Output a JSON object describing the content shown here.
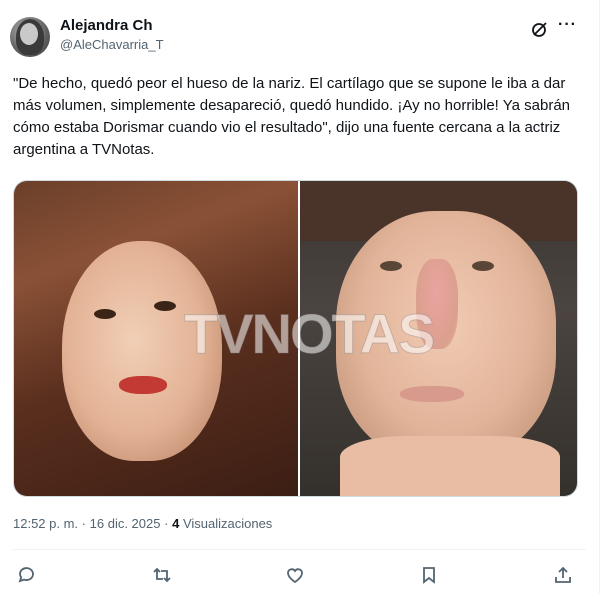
{
  "author": {
    "name": "Alejandra Ch",
    "handle": "@AleChavarria_T"
  },
  "header_icons": [
    "grok-icon",
    "more-options-icon"
  ],
  "more_glyph": "···",
  "tweet_text": "\"De hecho, quedó peor el hueso de la nariz. El cartílago que se supone le iba a dar más volumen, simplemente desapareció, quedó hundido. ¡Ay no horrible! Ya sabrán cómo estaba Dorismar cuando vio el resultado\", dijo una fuente cercana a la actriz argentina a TVNotas.",
  "media": {
    "watermark": "TVNOTAS",
    "photo_count": 2
  },
  "meta": {
    "time": "12:52 p. m.",
    "separator": "·",
    "date": "16 dic. 2025",
    "views_count": "4",
    "views_label": "Visualizaciones"
  },
  "actions": [
    "reply-icon",
    "repost-icon",
    "like-icon",
    "bookmark-icon",
    "share-icon"
  ],
  "colors": {
    "text": "#0f1419",
    "secondary": "#536471",
    "border": "#cfd9de"
  }
}
